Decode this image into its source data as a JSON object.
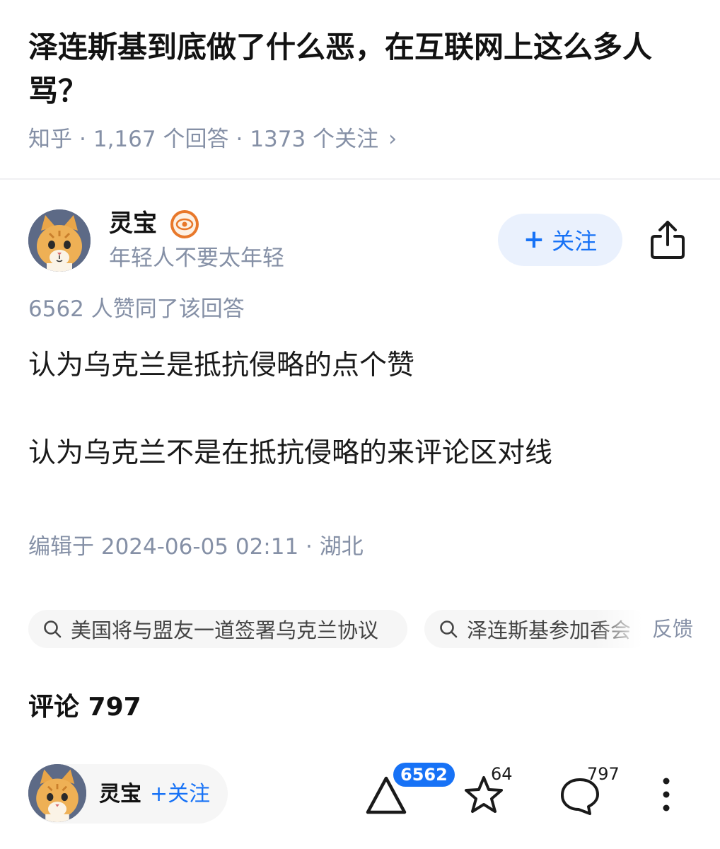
{
  "question": {
    "title": "泽连斯基到底做了什么恶，在互联网上这么多人骂？",
    "source": "知乎",
    "answers": "1,167 个回答",
    "followers": "1373 个关注",
    "separator": "·"
  },
  "author": {
    "name": "灵宝",
    "bio": "年轻人不要太年轻",
    "follow_label": "关注",
    "badge_icon": "eye-badge-icon",
    "share_icon": "share-icon"
  },
  "answer": {
    "voters_line": "6562 人赞同了该回答",
    "paragraphs": [
      "认为乌克兰是抵抗侵略的点个赞",
      "认为乌克兰不是在抵抗侵略的来评论区对线"
    ],
    "edited": "编辑于 2024-06-05 02:11 · 湖北"
  },
  "related_searches": [
    "美国将与盟友一道签署乌克兰协议",
    "泽连斯基参加香会"
  ],
  "feedback_label": "反馈",
  "comments": {
    "title": "评论 797"
  },
  "bottom_bar": {
    "author_name": "灵宝",
    "follow_label": "+关注",
    "upvotes": "6562",
    "favorites": "64",
    "comments": "797"
  },
  "colors": {
    "accent": "#1772f6",
    "muted": "#8590a6",
    "follow_bg": "#eaf1fd",
    "badge": "#e8782a"
  }
}
